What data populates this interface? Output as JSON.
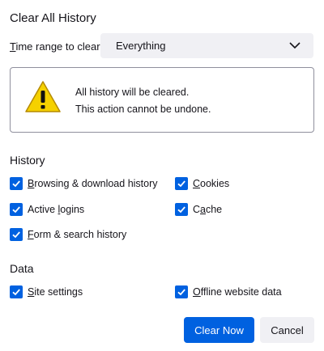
{
  "dialog": {
    "title": "Clear All History"
  },
  "time_range": {
    "label_prefix": "",
    "label_underlined": "T",
    "label_rest": "ime range to clear:",
    "selected": "Everything"
  },
  "warning": {
    "line1": "All history will be cleared.",
    "line2": "This action cannot be undone.",
    "icon": "warning-icon"
  },
  "history": {
    "heading": "History",
    "items": [
      {
        "ul": "B",
        "rest": "rowsing & download history",
        "checked": true
      },
      {
        "ul": "C",
        "rest": "ookies",
        "checked": true
      },
      {
        "pre": "Active ",
        "ul": "l",
        "rest": "ogins",
        "checked": true
      },
      {
        "pre": "C",
        "ul": "a",
        "rest": "che",
        "checked": true
      },
      {
        "ul": "F",
        "rest": "orm & search history",
        "checked": true
      }
    ]
  },
  "data_section": {
    "heading": "Data",
    "items": [
      {
        "ul": "S",
        "rest": "ite settings",
        "checked": true
      },
      {
        "ul": "O",
        "rest": "ffline website data",
        "checked": true
      }
    ]
  },
  "buttons": {
    "primary": "Clear Now",
    "secondary": "Cancel"
  },
  "colors": {
    "accent": "#0061e0",
    "neutral_bg": "#f0f0f4",
    "warning_yellow": "#f5d100"
  }
}
